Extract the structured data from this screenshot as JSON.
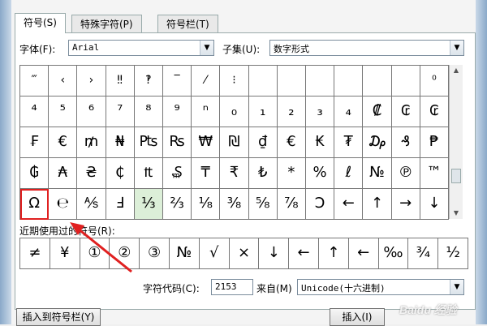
{
  "tabs": [
    {
      "label": "符号(S)"
    },
    {
      "label": "特殊字符(P)"
    },
    {
      "label": "符号栏(T)"
    }
  ],
  "font": {
    "label": "字体(F):",
    "value": "Arial"
  },
  "subset": {
    "label": "子集(U):",
    "value": "数字形式"
  },
  "symbol_rows": [
    [
      "‴",
      "‹",
      "›",
      "‼",
      "‽",
      "‾",
      "⁄",
      "⁝",
      "",
      "",
      "",
      "",
      "",
      "",
      "⁰"
    ],
    [
      "⁴",
      "⁵",
      "⁶",
      "⁷",
      "⁸",
      "⁹",
      "ⁿ",
      "₀",
      "₁",
      "₂",
      "₃",
      "₄",
      "₡",
      "₢",
      "₢"
    ],
    [
      "₣",
      "€",
      "₥",
      "₦",
      "₧",
      "₨",
      "₩",
      "₪",
      "₫",
      "€",
      "₭",
      "₮",
      "₯",
      "₰",
      "₱"
    ],
    [
      "₲",
      "₳",
      "₴",
      "₵",
      "₶",
      "₷",
      "₸",
      "₹",
      "₺",
      "*",
      "%",
      "ℓ",
      "№",
      "℗",
      "™"
    ],
    [
      "Ω",
      "℮",
      "⅍",
      "Ⅎ",
      "⅓",
      "⅔",
      "⅛",
      "⅜",
      "⅝",
      "⅞",
      "Ↄ",
      "←",
      "↑",
      "→",
      "↓"
    ]
  ],
  "recent": {
    "label": "近期使用过的符号(R):",
    "items": [
      "≠",
      "¥",
      "①",
      "②",
      "③",
      "№",
      "√",
      "×",
      "↓",
      "←",
      "↑",
      "←",
      "‰",
      "¾",
      "½"
    ]
  },
  "char_code": {
    "label": "字符代码(C):",
    "value": "2153"
  },
  "from": {
    "label": "来自(M)",
    "value": "Unicode(十六进制)"
  },
  "buttons": {
    "insert_to_bar": "插入到符号栏(Y)",
    "insert": "插入(I)"
  },
  "watermark": "Baidu 经验",
  "colors": {
    "selected_border": "#e02020",
    "highlight_cell": "#dcefd8",
    "arrow": "#e02020"
  }
}
